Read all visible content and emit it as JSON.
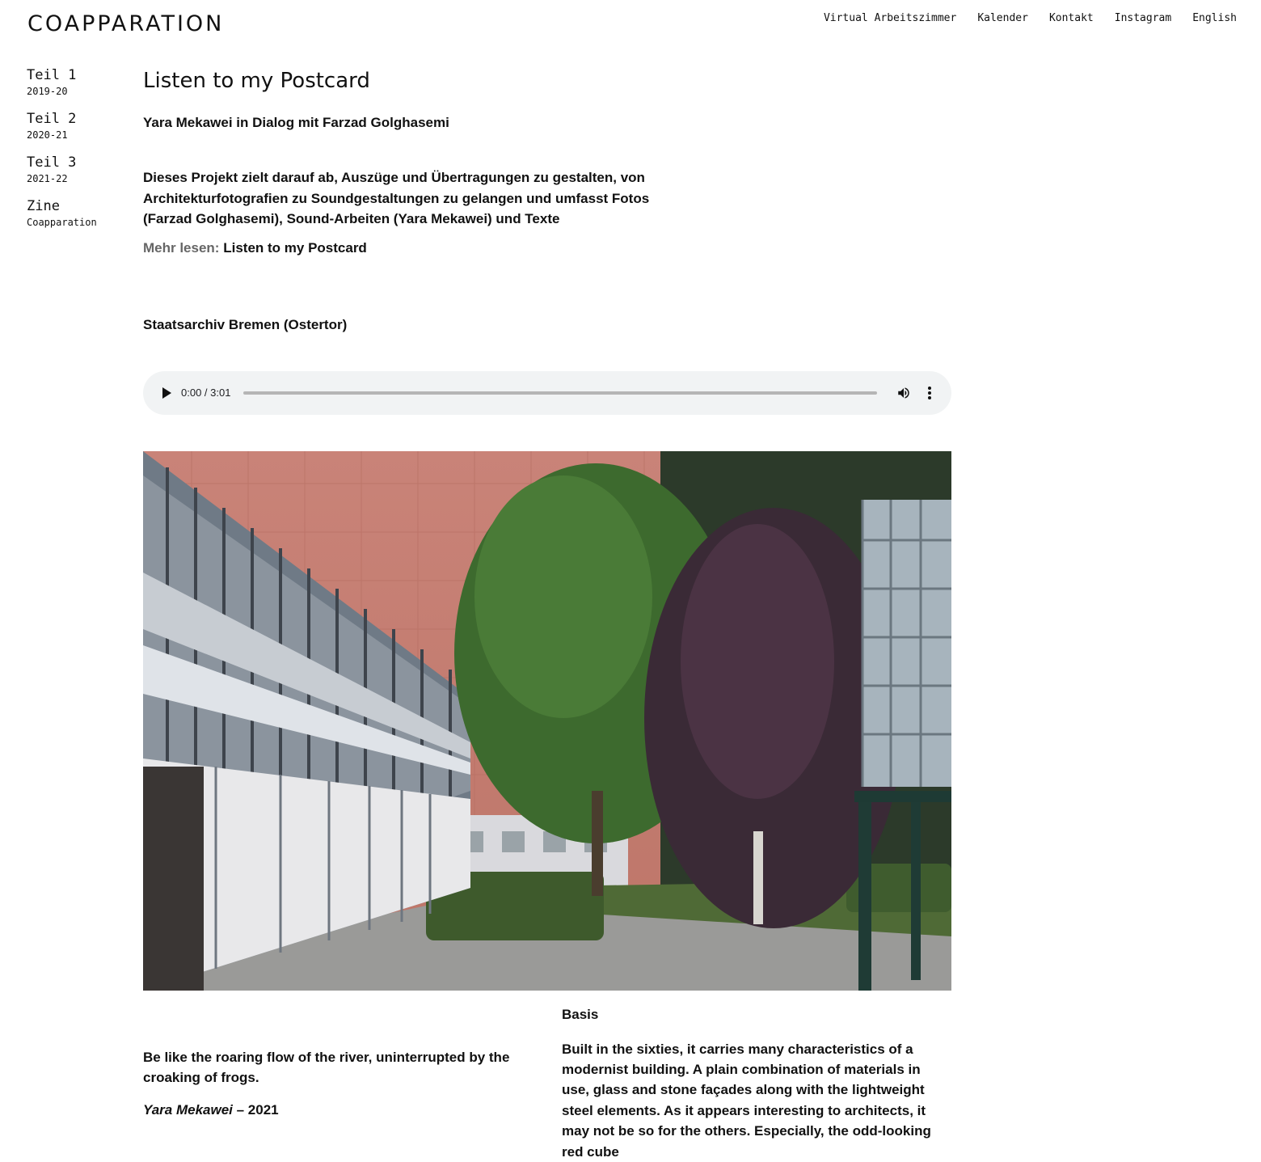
{
  "site": {
    "title": "COAPPARATION"
  },
  "nav": [
    {
      "label": "Virtual Arbeitszimmer"
    },
    {
      "label": "Kalender"
    },
    {
      "label": "Kontakt"
    },
    {
      "label": "Instagram"
    },
    {
      "label": "English"
    }
  ],
  "sidebar": [
    {
      "label": "Teil 1",
      "sub": "2019-20"
    },
    {
      "label": "Teil 2",
      "sub": "2020-21"
    },
    {
      "label": "Teil 3",
      "sub": "2021-22"
    },
    {
      "label": "Zine",
      "sub": "Coapparation"
    }
  ],
  "page": {
    "title": "Listen to my Postcard",
    "subtitle": "Yara Mekawei in Dialog mit Farzad Golghasemi",
    "intro": "Dieses Projekt zielt darauf ab, Auszüge und Übertragungen zu gestalten, von Architekturfotografien zu Soundgestaltungen zu gelangen und umfasst Fotos (Farzad Golghasemi), Sound-Arbeiten (Yara Mekawei) und Texte",
    "readmore_key": "Mehr lesen:",
    "readmore_link": "Listen to my Postcard",
    "location": "Staatsarchiv Bremen (Ostertor)"
  },
  "audio": {
    "time": "0:00 / 3:01",
    "progress": 0,
    "icons": {
      "play": "play-icon",
      "volume": "volume-icon",
      "more": "more-vertical-icon"
    }
  },
  "photo": {
    "description_name": "staatsarchiv-photo"
  },
  "quote": {
    "text": "Be like the roaring flow of the river, uninterrupted by the croaking of frogs.",
    "author": "Yara Mekawei",
    "dash_year": " – 2021"
  },
  "basis": {
    "title": "Basis",
    "text": "Built in the sixties, it carries many characteristics of a modernist building. A plain combination of materials in use, glass and stone façades along with the lightweight steel elements. As it appears interesting to architects, it may not be so for the others. Especially, the odd-looking red cube"
  }
}
